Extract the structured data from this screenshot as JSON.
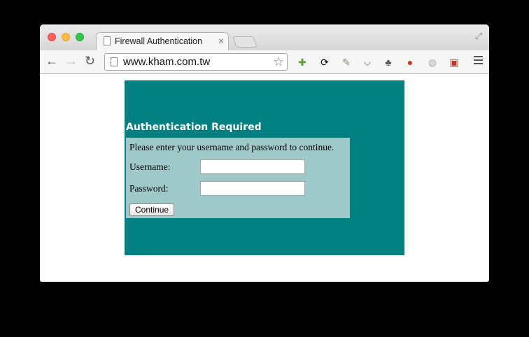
{
  "browser": {
    "tab_title": "Firewall Authentication",
    "tab_close": "×",
    "url": "www.kham.com.tw",
    "nav_back": "←",
    "nav_forward": "→",
    "nav_reload": "↻",
    "bookmark_star": "☆",
    "extensions": [
      "puzzle-icon",
      "sync-icon",
      "tool-icon",
      "pocket-icon",
      "evernote-icon",
      "santa-cookie-icon",
      "globe-icon",
      "bookmark-card-icon"
    ]
  },
  "page": {
    "heading": "Authentication Required",
    "instruction": "Please enter your username and password to continue.",
    "username_label": "Username:",
    "password_label": "Password:",
    "username_value": "",
    "password_value": "",
    "continue_label": "Continue"
  },
  "colors": {
    "panel_bg": "#008080",
    "form_bg": "#9fc9c9"
  }
}
